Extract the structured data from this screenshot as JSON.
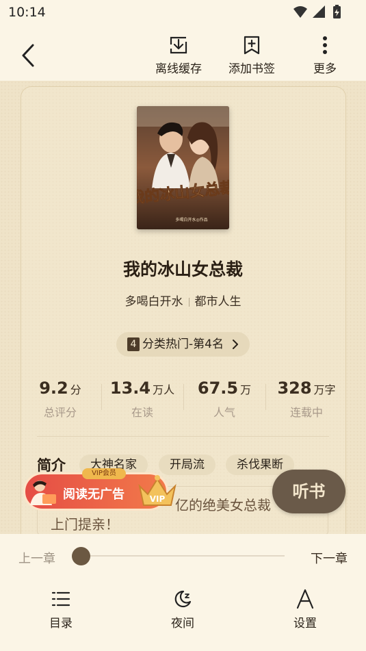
{
  "status_bar": {
    "time": "10:14"
  },
  "top_bar": {
    "actions": [
      {
        "label": "离线缓存",
        "icon": "download-icon"
      },
      {
        "label": "添加书签",
        "icon": "bookmark-add-icon"
      },
      {
        "label": "更多",
        "icon": "more-vertical-icon"
      }
    ]
  },
  "book": {
    "cover_title": "我的冰山女总裁",
    "cover_author_line": "多喝白开水◎作品",
    "title": "我的冰山女总裁",
    "author": "多喝白开水",
    "category": "都市人生",
    "rank_num": "4",
    "rank_text": "分类热门-第4名"
  },
  "stats": [
    {
      "value": "9.2",
      "unit": "分",
      "label": "总评分"
    },
    {
      "value": "13.4",
      "unit": "万人",
      "label": "在读"
    },
    {
      "value": "67.5",
      "unit": "万",
      "label": "人气"
    },
    {
      "value": "328",
      "unit": "万字",
      "label": "连载中"
    }
  ],
  "intro": {
    "heading": "简介",
    "tags": [
      "大神名家",
      "开局流",
      "杀伐果断"
    ],
    "text_line1": "亿的绝美女总裁",
    "text_line2": "上门提亲！"
  },
  "vip_banner": {
    "badge": "VIP会员",
    "text": "阅读无广告",
    "crown_text": "VIP"
  },
  "listen_button": {
    "label": "听书"
  },
  "chapter_nav": {
    "prev": "上一章",
    "next": "下一章",
    "progress": 0
  },
  "bottom_nav": [
    {
      "label": "目录",
      "icon": "list-icon"
    },
    {
      "label": "夜间",
      "icon": "moon-icon"
    },
    {
      "label": "设置",
      "icon": "font-settings-icon"
    }
  ],
  "colors": {
    "accent": "#6a5a49",
    "background": "#f6ecd7",
    "vip": "#e54d45"
  }
}
